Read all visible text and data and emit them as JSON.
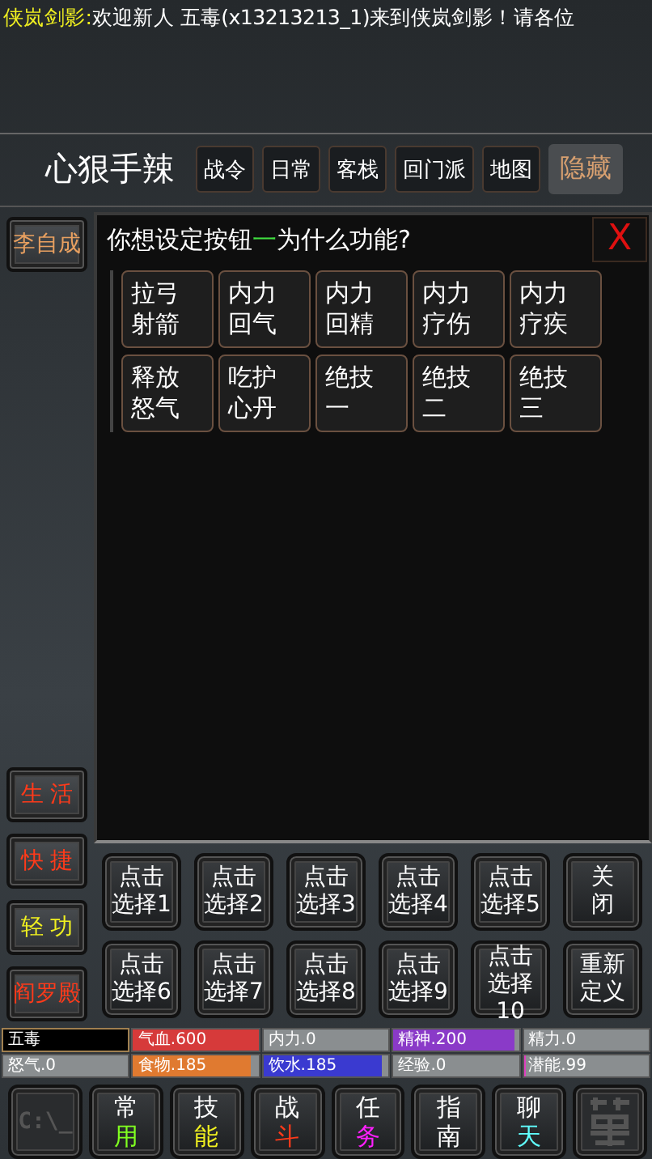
{
  "broadcast": {
    "source": "侠岚剑影:",
    "message": "欢迎新人  五毒(x13213213_1)来到侠岚剑影！请各位"
  },
  "header": {
    "title": "心狠手辣",
    "tabs": [
      {
        "label": "战令",
        "kind": "tab"
      },
      {
        "label": "日常",
        "kind": "tab"
      },
      {
        "label": "客栈",
        "kind": "tab"
      },
      {
        "label": "回门派",
        "kind": "tab"
      },
      {
        "label": "地图",
        "kind": "tab"
      },
      {
        "label": "隐藏",
        "kind": "hide"
      }
    ]
  },
  "side": {
    "npc": {
      "label": "李自成",
      "color": "#e8a060"
    },
    "buttons": [
      {
        "label": "生 活",
        "color": "#ff3a1a"
      },
      {
        "label": "快 捷",
        "color": "#ff3a1a"
      },
      {
        "label": "轻 功",
        "color": "#f0f020"
      },
      {
        "label": "阎罗殿",
        "color": "#ff3a1a"
      }
    ]
  },
  "dialog": {
    "title": "你想设定按钮",
    "highlight": "一",
    "title_end": "为什么功能?",
    "close": "X",
    "options": [
      [
        "拉弓",
        "射箭"
      ],
      [
        "内力",
        "回气"
      ],
      [
        "内力",
        "回精"
      ],
      [
        "内力",
        "疗伤"
      ],
      [
        "内力",
        "疗疾"
      ],
      [
        "释放",
        "怒气"
      ],
      [
        "吃护",
        "心丹"
      ],
      [
        "绝技",
        "一"
      ],
      [
        "绝技",
        "二"
      ],
      [
        "绝技",
        "三"
      ]
    ]
  },
  "slots": [
    [
      "点击",
      "选择1"
    ],
    [
      "点击",
      "选择2"
    ],
    [
      "点击",
      "选择3"
    ],
    [
      "点击",
      "选择4"
    ],
    [
      "点击",
      "选择5"
    ],
    [
      "关",
      "闭"
    ],
    [
      "点击",
      "选择6"
    ],
    [
      "点击",
      "选择7"
    ],
    [
      "点击",
      "选择8"
    ],
    [
      "点击",
      "选择9"
    ],
    [
      "点击",
      "选择10"
    ],
    [
      "重新",
      "定义"
    ]
  ],
  "stats": [
    {
      "label": "五毒",
      "kind": "name"
    },
    {
      "label": "气血.600",
      "level": 1,
      "color": "#d63a3a"
    },
    {
      "label": "内力.0"
    },
    {
      "label": "精神.200",
      "level": 0.97,
      "color": "#8a3ac8"
    },
    {
      "label": "精力.0"
    },
    {
      "label": "怒气.0"
    },
    {
      "label": "食物.185",
      "level": 0.94,
      "color": "#e07a30"
    },
    {
      "label": "饮水.185",
      "level": 0.94,
      "color": "#3a3ad0"
    },
    {
      "label": "经验.0"
    },
    {
      "label": "潜能.99",
      "level": 0.02,
      "color": "#e040c0"
    }
  ],
  "nav": [
    {
      "kind": "console",
      "label": "C:\\_"
    },
    {
      "kind": "menu",
      "top": "常",
      "bottom": "用",
      "color": "#80ff20"
    },
    {
      "kind": "menu",
      "top": "技",
      "bottom": "能",
      "color": "#f0f020"
    },
    {
      "kind": "menu",
      "top": "战",
      "bottom": "斗",
      "color": "#ff3a1a"
    },
    {
      "kind": "menu",
      "top": "任",
      "bottom": "务",
      "color": "#ff20ff"
    },
    {
      "kind": "menu",
      "top": "指",
      "bottom": "南",
      "color": "#ffffff"
    },
    {
      "kind": "menu",
      "top": "聊",
      "bottom": "天",
      "color": "#60ffff"
    },
    {
      "kind": "seal"
    }
  ]
}
